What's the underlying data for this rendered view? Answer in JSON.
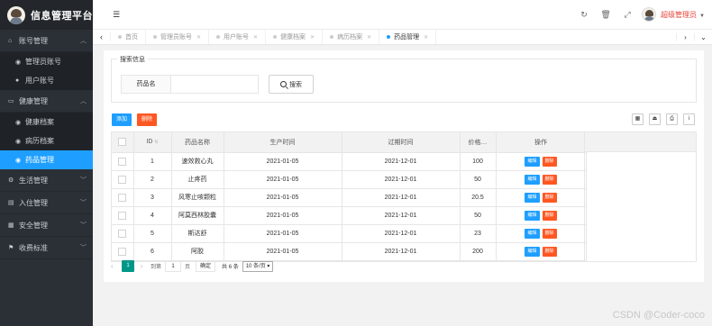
{
  "app": {
    "title": "信息管理平台"
  },
  "sidebar": {
    "groups": [
      {
        "label": "账号管理",
        "icon": "home-icon",
        "open": true,
        "items": [
          {
            "label": "管理员账号",
            "icon": "palette-icon"
          },
          {
            "label": "用户账号",
            "icon": "user-icon"
          }
        ]
      },
      {
        "label": "健康管理",
        "icon": "card-icon",
        "open": true,
        "items": [
          {
            "label": "健康档案",
            "icon": "palette-icon"
          },
          {
            "label": "病历档案",
            "icon": "palette-icon"
          },
          {
            "label": "药品管理",
            "icon": "palette-icon",
            "active": true
          }
        ]
      },
      {
        "label": "生活管理",
        "icon": "gear-icon"
      },
      {
        "label": "入住管理",
        "icon": "doc-icon"
      },
      {
        "label": "安全管理",
        "icon": "calendar-icon"
      },
      {
        "label": "收费标准",
        "icon": "flag-icon"
      }
    ]
  },
  "header": {
    "username": "超级管理员"
  },
  "tabs": [
    {
      "label": "首页"
    },
    {
      "label": "管理员账号"
    },
    {
      "label": "用户账号"
    },
    {
      "label": "健康档案"
    },
    {
      "label": "病历档案"
    },
    {
      "label": "药品管理",
      "active": true
    }
  ],
  "search": {
    "legend": "搜索信息",
    "field_label": "药品名",
    "value": "",
    "button_label": "搜索"
  },
  "toolbar": {
    "add_label": "添加",
    "delete_label": "删除"
  },
  "table": {
    "columns": [
      "ID",
      "药品名称",
      "生产时间",
      "过期时间",
      "价格…",
      "操作"
    ],
    "edit_label": "编辑",
    "remove_label": "删除",
    "rows": [
      {
        "id": "1",
        "name": "速效救心丸",
        "produced": "2021-01-05",
        "expires": "2021-12-01",
        "price": "100"
      },
      {
        "id": "2",
        "name": "止疼药",
        "produced": "2021-01-05",
        "expires": "2021-12-01",
        "price": "50"
      },
      {
        "id": "3",
        "name": "风寒止咳颗粒",
        "produced": "2021-01-05",
        "expires": "2021-12-01",
        "price": "20.5"
      },
      {
        "id": "4",
        "name": "阿莫西林胶囊",
        "produced": "2021-01-05",
        "expires": "2021-12-01",
        "price": "50"
      },
      {
        "id": "5",
        "name": "斯达舒",
        "produced": "2021-01-05",
        "expires": "2021-12-01",
        "price": "23"
      },
      {
        "id": "6",
        "name": "阿胶",
        "produced": "2021-01-05",
        "expires": "2021-12-01",
        "price": "200"
      }
    ]
  },
  "pagination": {
    "current": "1",
    "goto_label": "到第",
    "goto_value": "1",
    "page_unit": "页",
    "confirm_label": "确定",
    "total_text": "共 6 条",
    "page_size": "10 条/页"
  },
  "watermark": "CSDN @Coder-coco"
}
